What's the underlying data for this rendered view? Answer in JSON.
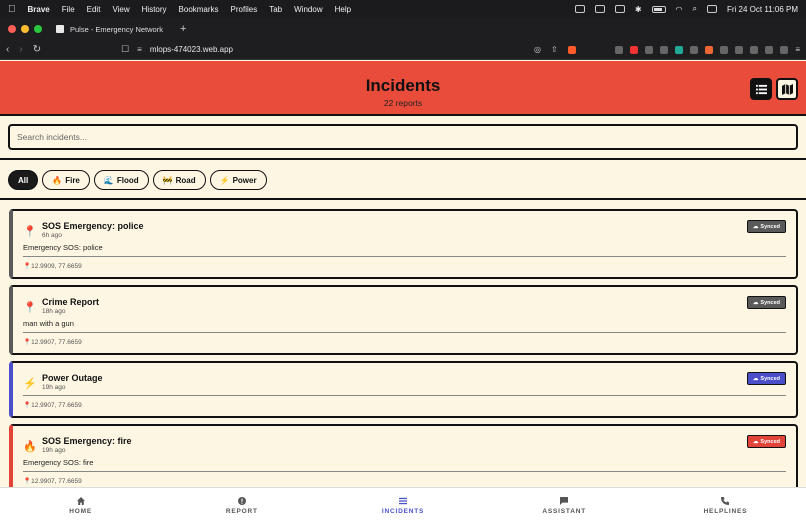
{
  "menubar": {
    "app": "Brave",
    "items": [
      "File",
      "Edit",
      "View",
      "History",
      "Bookmarks",
      "Profiles",
      "Tab",
      "Window",
      "Help"
    ],
    "datetime": "Fri 24 Oct  11:06 PM"
  },
  "browser": {
    "tab_title": "Pulse - Emergency Network",
    "url": "mlops-474023.web.app"
  },
  "header": {
    "title": "Incidents",
    "subtitle": "22 reports",
    "accent": "#ea4c3c"
  },
  "search": {
    "placeholder": "Search incidents..."
  },
  "filters": [
    {
      "label": "All",
      "icon": ""
    },
    {
      "label": "Fire",
      "icon": "🔥"
    },
    {
      "label": "Flood",
      "icon": "🌊"
    },
    {
      "label": "Road",
      "icon": "🚧"
    },
    {
      "label": "Power",
      "icon": "⚡"
    }
  ],
  "incidents": [
    {
      "title": "SOS Emergency: police",
      "time": "6h ago",
      "description": "Emergency SOS: police",
      "location": "12.9909, 77.6659",
      "status": "Synced",
      "icon": "📍",
      "color": "#5a5a5a"
    },
    {
      "title": "Crime Report",
      "time": "18h ago",
      "description": "man with a gun",
      "location": "12.9907, 77.6659",
      "status": "Synced",
      "icon": "📍",
      "color": "#5a5a5a"
    },
    {
      "title": "Power Outage",
      "time": "19h ago",
      "description": "",
      "location": "12.9907, 77.6659",
      "status": "Synced",
      "icon": "⚡",
      "color": "#4a4fc9"
    },
    {
      "title": "SOS Emergency: fire",
      "time": "19h ago",
      "description": "Emergency SOS: fire",
      "location": "12.9907, 77.6659",
      "status": "Synced",
      "icon": "🔥",
      "color": "#e2443a"
    }
  ],
  "bottom_nav": [
    {
      "label": "HOME",
      "icon": "home-icon"
    },
    {
      "label": "REPORT",
      "icon": "alert-icon"
    },
    {
      "label": "INCIDENTS",
      "icon": "list-icon"
    },
    {
      "label": "ASSISTANT",
      "icon": "chat-icon"
    },
    {
      "label": "HELPLINES",
      "icon": "phone-icon"
    }
  ],
  "nav_active_color": "#4a52c8"
}
